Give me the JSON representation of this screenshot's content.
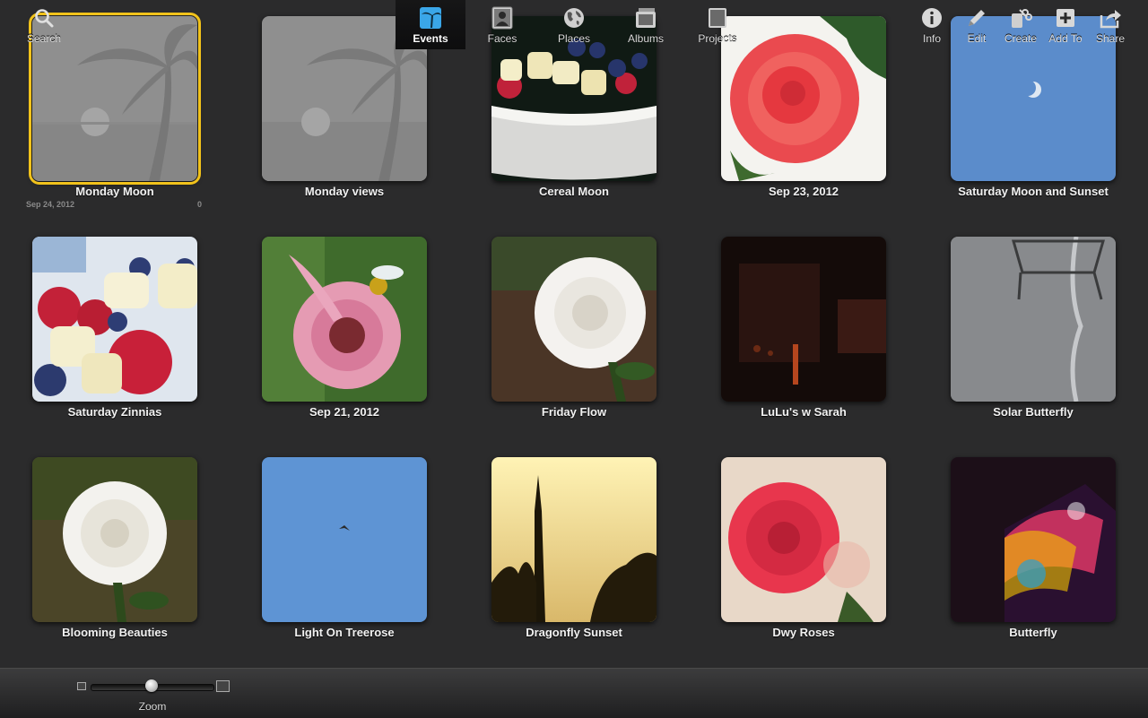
{
  "events": [
    {
      "title": "Monday Moon",
      "date": "Sep 24, 2012",
      "count": "0",
      "selected": true
    },
    {
      "title": "Monday views"
    },
    {
      "title": "Cereal Moon"
    },
    {
      "title": "Sep 23, 2012"
    },
    {
      "title": "Saturday Moon and Sunset"
    },
    {
      "title": "Saturday Zinnias"
    },
    {
      "title": "Sep 21, 2012"
    },
    {
      "title": "Friday Flow"
    },
    {
      "title": "LuLu's w Sarah"
    },
    {
      "title": "Solar Butterfly"
    },
    {
      "title": "Blooming Beauties"
    },
    {
      "title": "Light On Treerose"
    },
    {
      "title": "Dragonfly Sunset"
    },
    {
      "title": "Dwy Roses"
    },
    {
      "title": "Butterfly"
    }
  ],
  "toolbar": {
    "search": {
      "label": "Search",
      "icon": "magnifier-icon"
    },
    "zoom": {
      "label": "Zoom",
      "level": 0.5
    },
    "tabs": [
      {
        "label": "Events",
        "icon": "palm-tree-icon",
        "active": true
      },
      {
        "label": "Faces",
        "icon": "portrait-icon"
      },
      {
        "label": "Places",
        "icon": "globe-icon"
      },
      {
        "label": "Albums",
        "icon": "album-icon"
      },
      {
        "label": "Projects",
        "icon": "book-icon"
      }
    ],
    "actions": [
      {
        "label": "Info",
        "icon": "info-icon"
      },
      {
        "label": "Edit",
        "icon": "pencil-icon"
      },
      {
        "label": "Create",
        "icon": "scissors-icon"
      },
      {
        "label": "Add To",
        "icon": "plus-icon"
      },
      {
        "label": "Share",
        "icon": "share-arrow-icon"
      }
    ]
  },
  "colors": {
    "selection": "#f1c21b",
    "background": "#2b2b2c"
  }
}
